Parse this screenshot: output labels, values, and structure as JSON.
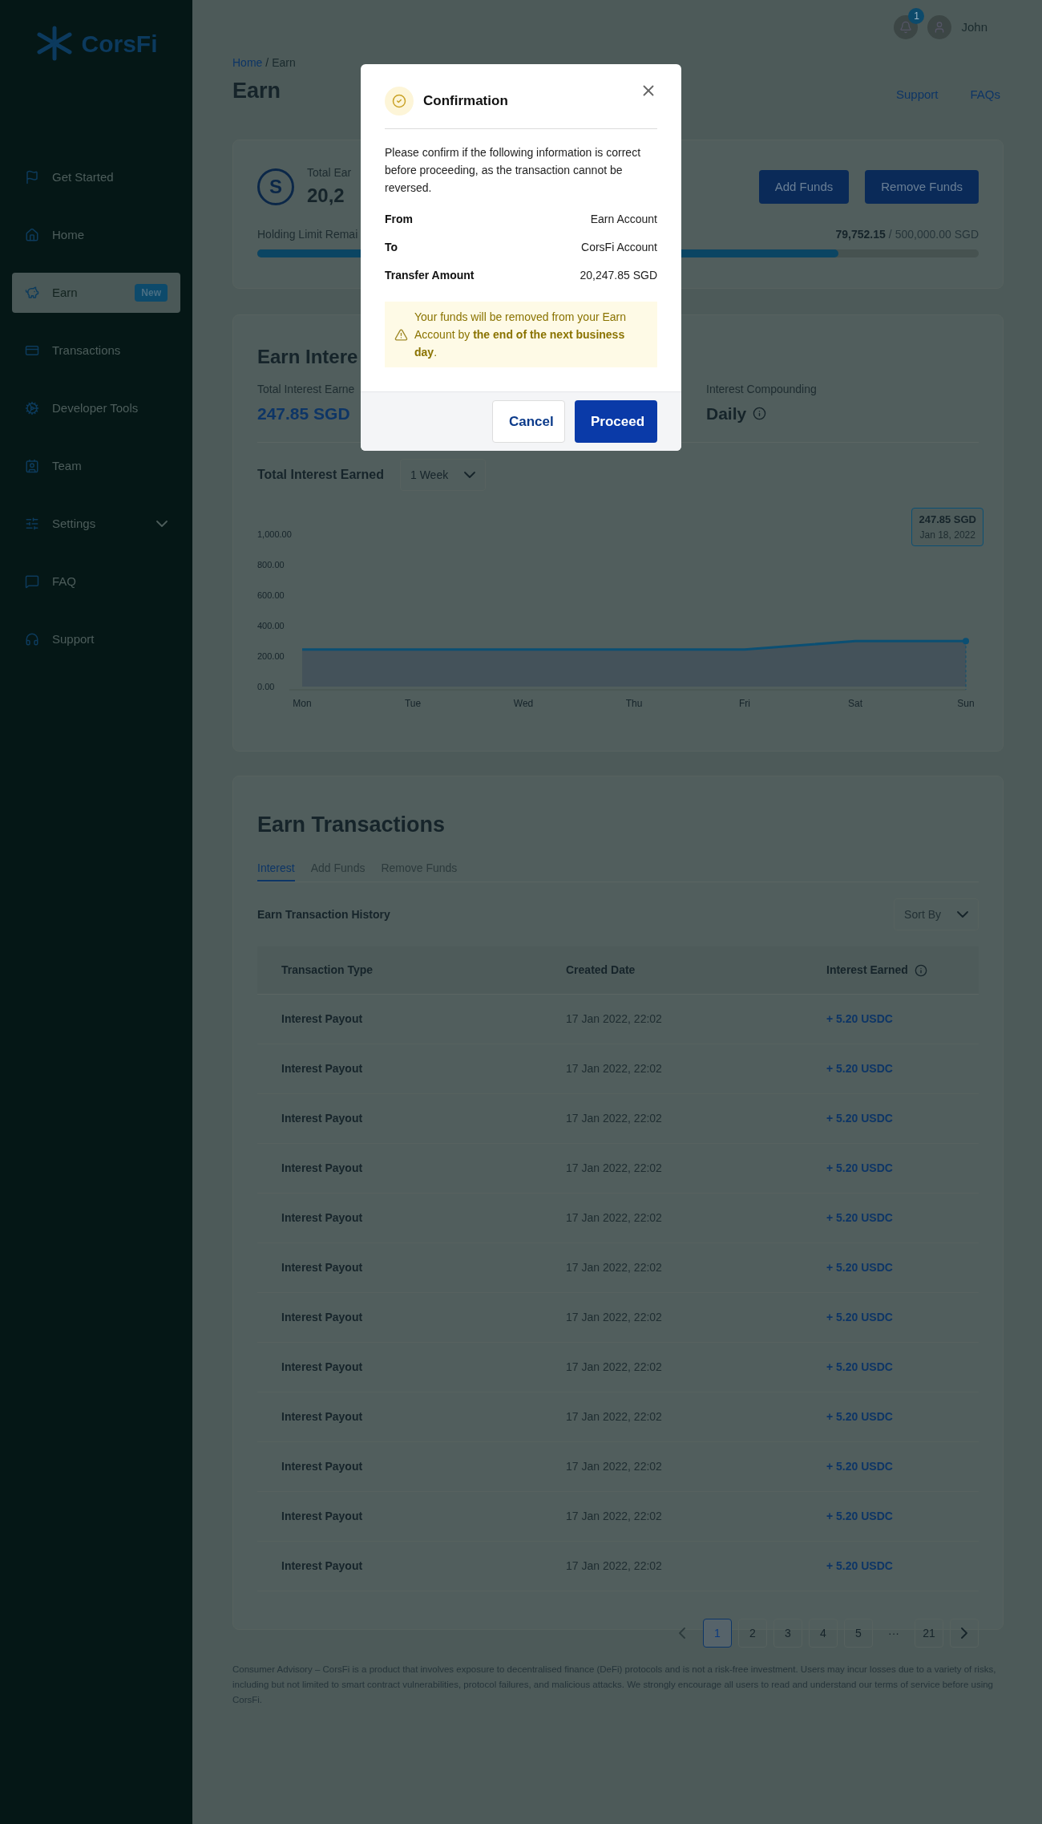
{
  "sidebar": {
    "logo": "CorsFi",
    "items": [
      {
        "label": "Get Started",
        "selected": false
      },
      {
        "label": "Home",
        "selected": false
      },
      {
        "label": "Earn",
        "selected": true,
        "badge": "New"
      },
      {
        "label": "Transactions",
        "selected": false
      },
      {
        "label": "Developer Tools",
        "selected": false
      },
      {
        "label": "Team",
        "selected": false
      },
      {
        "label": "Settings",
        "selected": false,
        "expanded": false
      },
      {
        "label": "FAQ",
        "selected": false
      },
      {
        "label": "Support",
        "selected": false
      }
    ]
  },
  "header": {
    "notifications": "1",
    "user": "John"
  },
  "breadcrumb": {
    "separator": "/",
    "items": [
      {
        "label": "Home",
        "link": true
      },
      {
        "label": "Earn",
        "link": false
      }
    ]
  },
  "page_title": "Earn",
  "header_links": [
    "Support",
    "FAQs"
  ],
  "balance_card": {
    "coin": "S",
    "label": "Total Ear",
    "amount": "20,2",
    "buttons": [
      "Add Funds",
      "Remove Funds"
    ],
    "limit_label": "Holding Limit Remai",
    "limit_value": "79,752.15",
    "limit_separator": "/",
    "limit_total": "500,000.00 SGD",
    "level": 0.805
  },
  "interest_card": {
    "title": "Earn Intere",
    "stats": [
      {
        "label": "Total Interest Earne",
        "value": "247.85 SGD",
        "kind": "amount"
      },
      {
        "label": "Interest Compounding",
        "value": "Daily",
        "kind": "info"
      }
    ],
    "chart_title": "Total Interest Earned",
    "range": "1 Week",
    "tooltip": {
      "value": "247.85 SGD",
      "date": "Jan 18, 2022"
    },
    "chart_data": {
      "type": "area",
      "categories": [
        "Mon",
        "Tue",
        "Wed",
        "Thu",
        "Fri",
        "Sat",
        "Sun"
      ],
      "series": [
        {
          "color": "#0b4f73",
          "values": [
            243,
            243,
            243,
            243,
            243,
            299,
            299
          ]
        }
      ],
      "ylim": [
        0,
        1000
      ],
      "yticks": [
        {
          "value": 0,
          "label": "0.00"
        },
        {
          "value": 200,
          "label": "200.00"
        },
        {
          "value": 400,
          "label": "400.00"
        },
        {
          "value": 600,
          "label": "600.00"
        },
        {
          "value": 800,
          "label": "800.00"
        },
        {
          "value": 1000,
          "label": "1,000.00"
        }
      ]
    }
  },
  "transactions": {
    "title": "Earn Transactions",
    "tabs": [
      {
        "label": "Interest",
        "selected": true
      },
      {
        "label": "Add Funds",
        "selected": false
      },
      {
        "label": "Remove Funds",
        "selected": false
      }
    ],
    "subtitle": "Earn Transaction History",
    "sort": {
      "placeholder": "Sort By"
    },
    "columns": [
      "Transaction Type",
      "Created Date",
      "Interest Earned"
    ],
    "rows": [
      [
        "Interest Payout",
        "17 Jan 2022, 22:02",
        "+ 5.20 USDC"
      ],
      [
        "Interest Payout",
        "17 Jan 2022, 22:02",
        "+ 5.20 USDC"
      ],
      [
        "Interest Payout",
        "17 Jan 2022, 22:02",
        "+ 5.20 USDC"
      ],
      [
        "Interest Payout",
        "17 Jan 2022, 22:02",
        "+ 5.20 USDC"
      ],
      [
        "Interest Payout",
        "17 Jan 2022, 22:02",
        "+ 5.20 USDC"
      ],
      [
        "Interest Payout",
        "17 Jan 2022, 22:02",
        "+ 5.20 USDC"
      ],
      [
        "Interest Payout",
        "17 Jan 2022, 22:02",
        "+ 5.20 USDC"
      ],
      [
        "Interest Payout",
        "17 Jan 2022, 22:02",
        "+ 5.20 USDC"
      ],
      [
        "Interest Payout",
        "17 Jan 2022, 22:02",
        "+ 5.20 USDC"
      ],
      [
        "Interest Payout",
        "17 Jan 2022, 22:02",
        "+ 5.20 USDC"
      ],
      [
        "Interest Payout",
        "17 Jan 2022, 22:02",
        "+ 5.20 USDC"
      ],
      [
        "Interest Payout",
        "17 Jan 2022, 22:02",
        "+ 5.20 USDC"
      ]
    ],
    "pages": [
      {
        "label": "1",
        "selected": true,
        "kind": "page"
      },
      {
        "label": "2",
        "selected": false,
        "kind": "page"
      },
      {
        "label": "3",
        "selected": false,
        "kind": "page"
      },
      {
        "label": "4",
        "selected": false,
        "kind": "page"
      },
      {
        "label": "5",
        "selected": false,
        "kind": "page"
      },
      {
        "label": "···",
        "kind": "gap"
      },
      {
        "label": "21",
        "selected": false,
        "kind": "page"
      }
    ]
  },
  "footer": "Consumer Advisory – CorsFi is a product that involves exposure to decentralised finance (DeFi) protocols and is not a risk-free investment. Users may incur losses due to a variety of risks, including but not limited to smart contract vulnerabilities, protocol failures, and malicious attacks. We strongly encourage all users to read and understand our terms of service before using CorsFi.",
  "modal": {
    "title": "Confirmation",
    "message": "Please confirm if the following information is correct before proceeding, as the transaction cannot be reversed.",
    "details": [
      {
        "label": "From",
        "value": "Earn Account"
      },
      {
        "label": "To",
        "value": "CorsFi Account"
      },
      {
        "label": "Transfer Amount",
        "value": "20,247.85 SGD"
      }
    ],
    "warning": "Your funds will be removed from your Earn Account by **the end of the next business day**.",
    "buttons": [
      {
        "label": "Cancel",
        "kind": "secondary"
      },
      {
        "label": "Proceed",
        "kind": "primary"
      }
    ]
  }
}
